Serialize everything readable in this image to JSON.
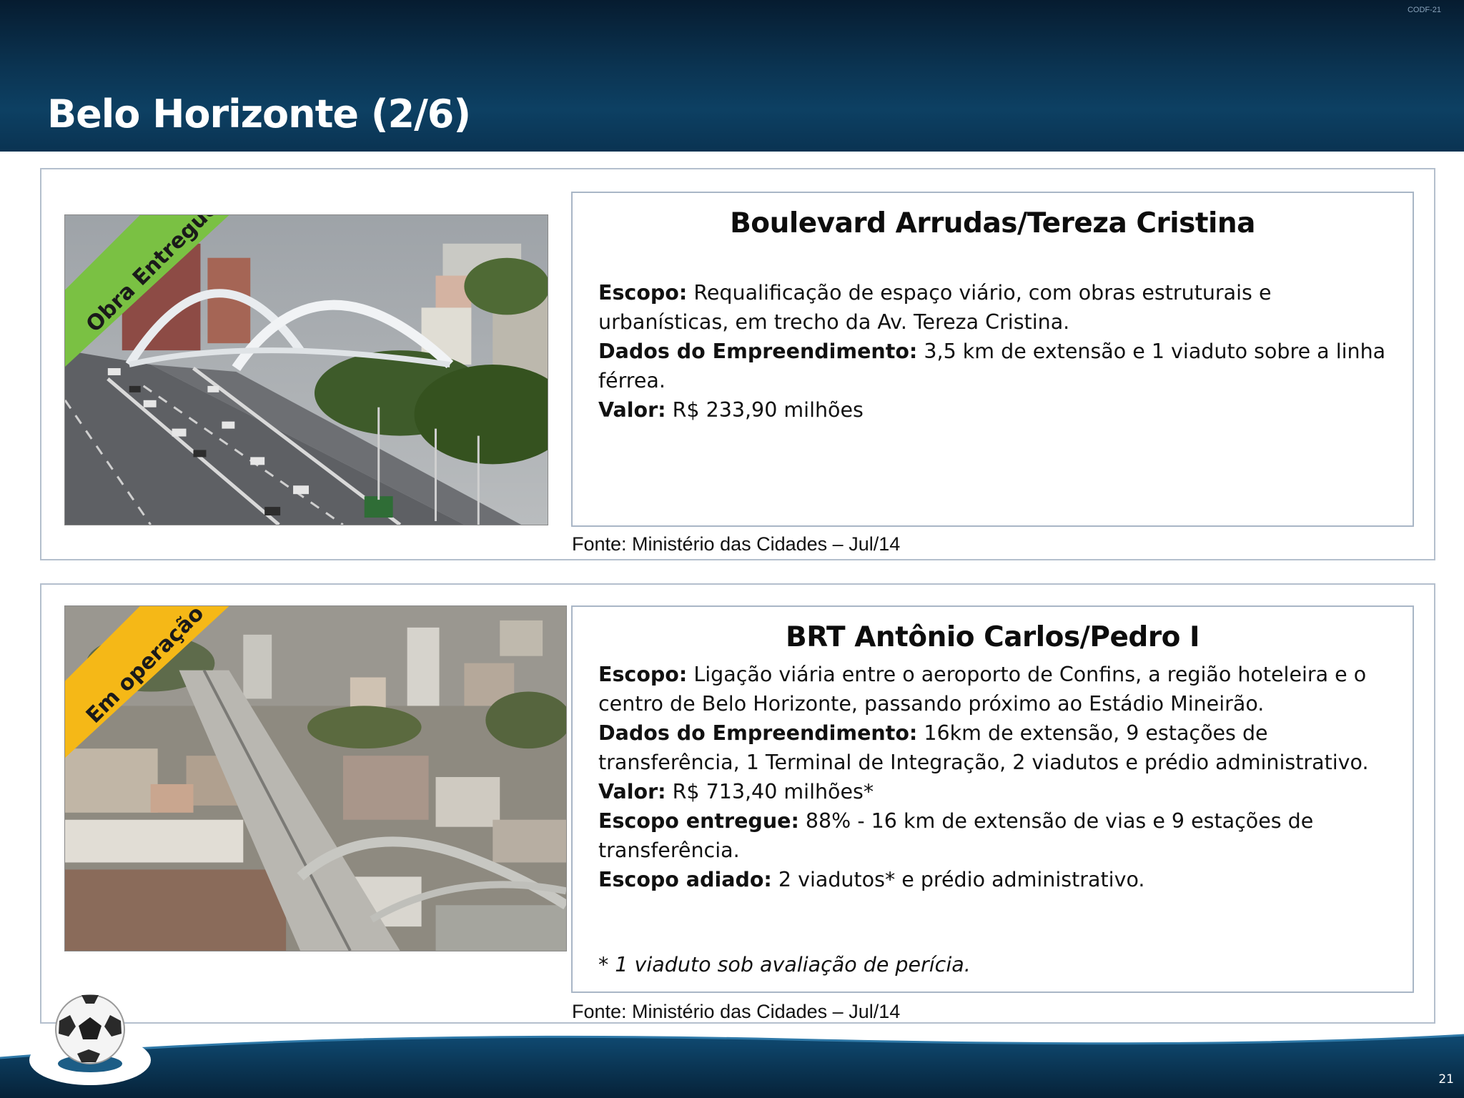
{
  "header": {
    "doc_code": "CODF-21",
    "title": "Belo Horizonte (2/6)"
  },
  "projects": [
    {
      "status_badge": "Obra Entregue",
      "status_color": "#7ac143",
      "title": "Boulevard Arrudas/Tereza Cristina",
      "lines": [
        {
          "label": "Escopo:",
          "text": " Requalificação de espaço viário, com obras estruturais e urbanísticas, em trecho da Av. Tereza Cristina."
        },
        {
          "label": "Dados do Empreendimento:",
          "text": " 3,5 km de extensão e 1 viaduto sobre a linha férrea."
        },
        {
          "label": "Valor:",
          "text": " R$ 233,90 milhões"
        }
      ],
      "source": "Fonte: Ministério das Cidades – Jul/14"
    },
    {
      "status_badge": "Em operação",
      "status_color": "#f5b817",
      "title": "BRT Antônio Carlos/Pedro I",
      "lines": [
        {
          "label": "Escopo:",
          "text": " Ligação viária entre o aeroporto de Confins, a região hoteleira e o centro de Belo Horizonte, passando próximo ao Estádio Mineirão."
        },
        {
          "label": "Dados do Empreendimento:",
          "text": " 16km de extensão, 9 estações de transferência, 1 Terminal de Integração, 2 viadutos e prédio administrativo."
        },
        {
          "label": "Valor:",
          "text": " R$ 713,40 milhões*"
        },
        {
          "label": "Escopo entregue:",
          "text": " 88% -  16 km de extensão de vias e 9 estações de transferência."
        },
        {
          "label": "Escopo adiado:",
          "text": " 2 viadutos* e prédio administrativo."
        }
      ],
      "footnote": "* 1 viaduto sob avaliação de perícia.",
      "source": "Fonte: Ministério das Cidades – Jul/14"
    }
  ],
  "footer": {
    "page_number": "21"
  }
}
